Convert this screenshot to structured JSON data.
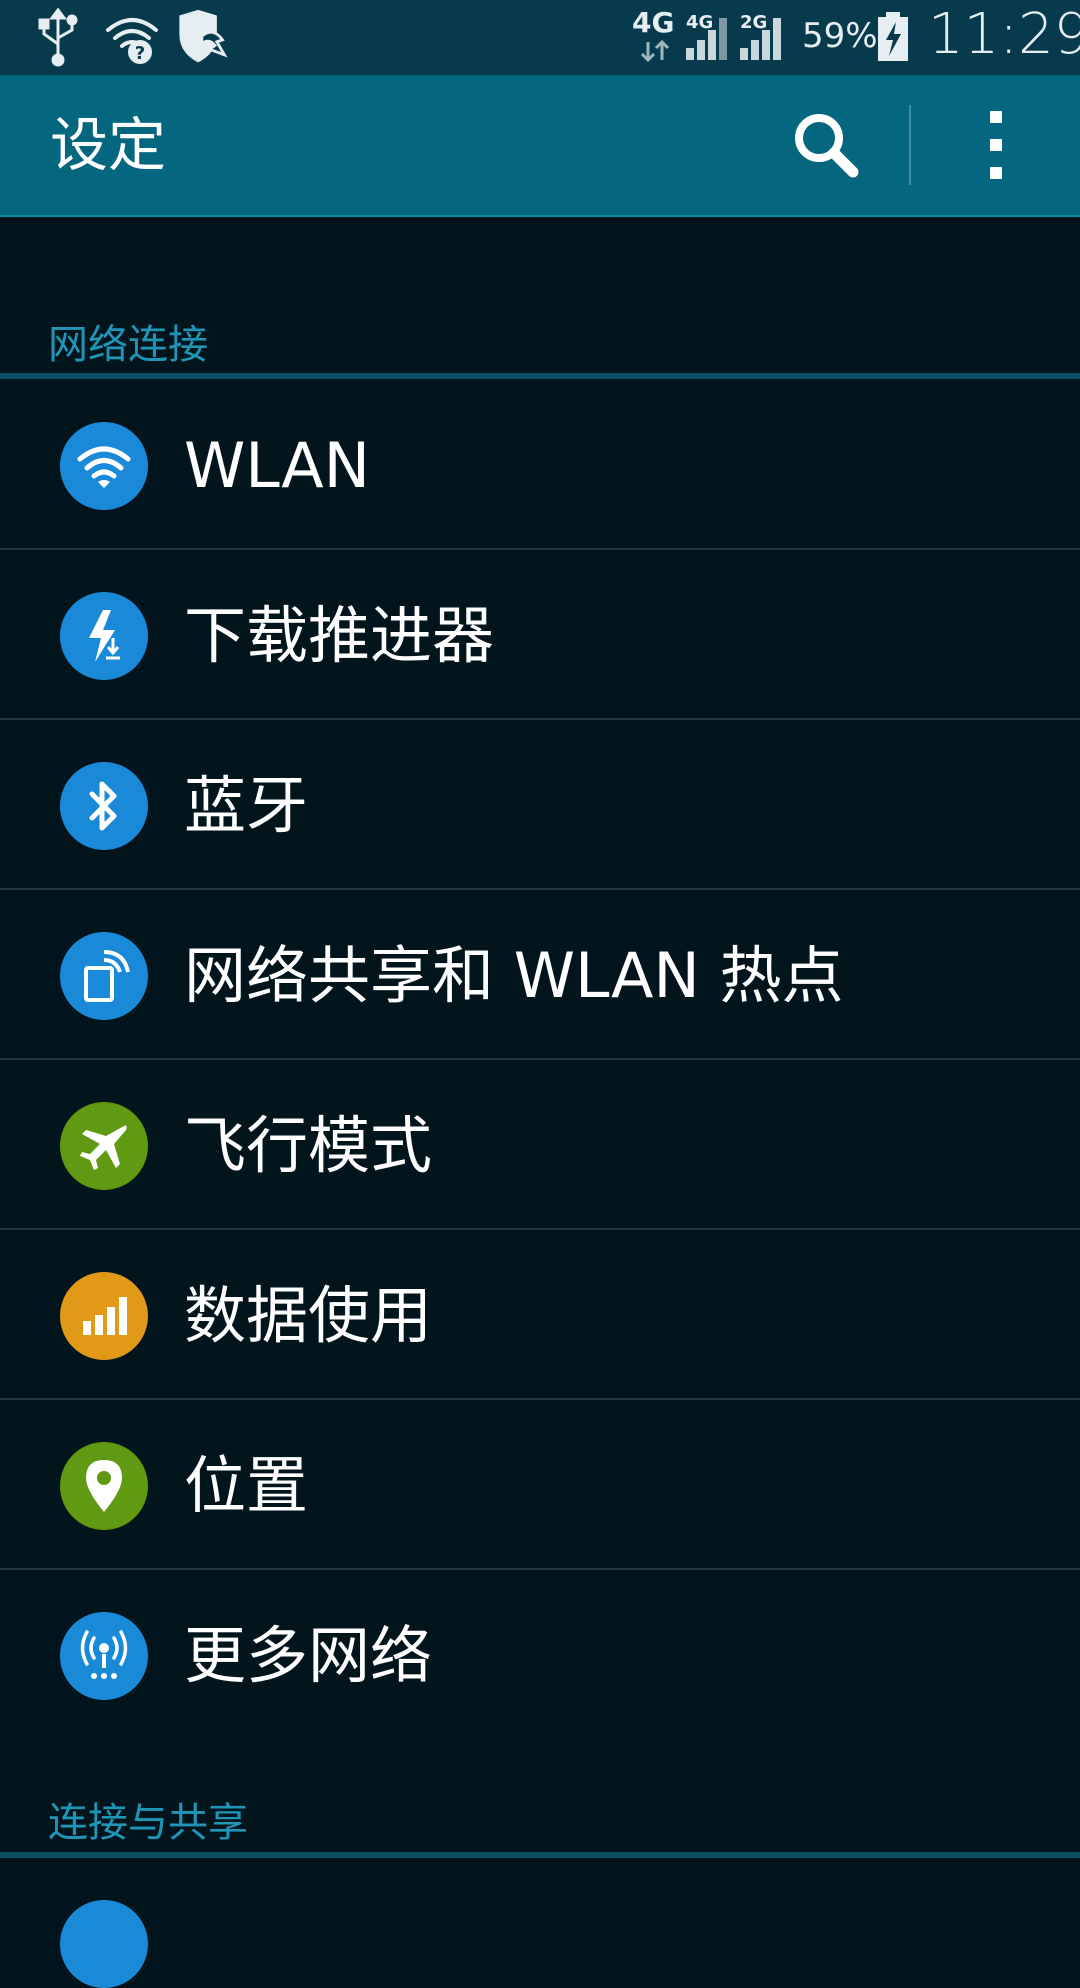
{
  "status_bar": {
    "icons_left": [
      "usb-icon",
      "wifi-question-icon",
      "shield-icon"
    ],
    "network_4g_label": "4G",
    "signal1_label": "4G",
    "signal2_label": "2G",
    "battery_percent": "59%",
    "time": "11:29"
  },
  "action_bar": {
    "title": "设定",
    "search_icon": "search-icon",
    "more_icon": "overflow-menu-icon"
  },
  "sections": [
    {
      "header": "网络连接",
      "items": [
        {
          "label": "WLAN",
          "icon": "wifi-icon",
          "color": "#1a8ad8"
        },
        {
          "label": "下载推进器",
          "icon": "download-booster-icon",
          "color": "#1a8ad8"
        },
        {
          "label": "蓝牙",
          "icon": "bluetooth-icon",
          "color": "#1a8ad8"
        },
        {
          "label": "网络共享和 WLAN 热点",
          "icon": "hotspot-icon",
          "color": "#1a8ad8"
        },
        {
          "label": "飞行模式",
          "icon": "airplane-icon",
          "color": "#5f9a12"
        },
        {
          "label": "数据使用",
          "icon": "data-usage-icon",
          "color": "#e09a17"
        },
        {
          "label": "位置",
          "icon": "location-icon",
          "color": "#5f9a12"
        },
        {
          "label": "更多网络",
          "icon": "more-networks-icon",
          "color": "#1a8ad8"
        }
      ]
    },
    {
      "header": "连接与共享",
      "items": []
    }
  ],
  "colors": {
    "status_bar_bg": "#073a4c",
    "action_bar_bg": "#05677f",
    "list_bg": "#02151d",
    "section_header": "#1f96b8"
  }
}
